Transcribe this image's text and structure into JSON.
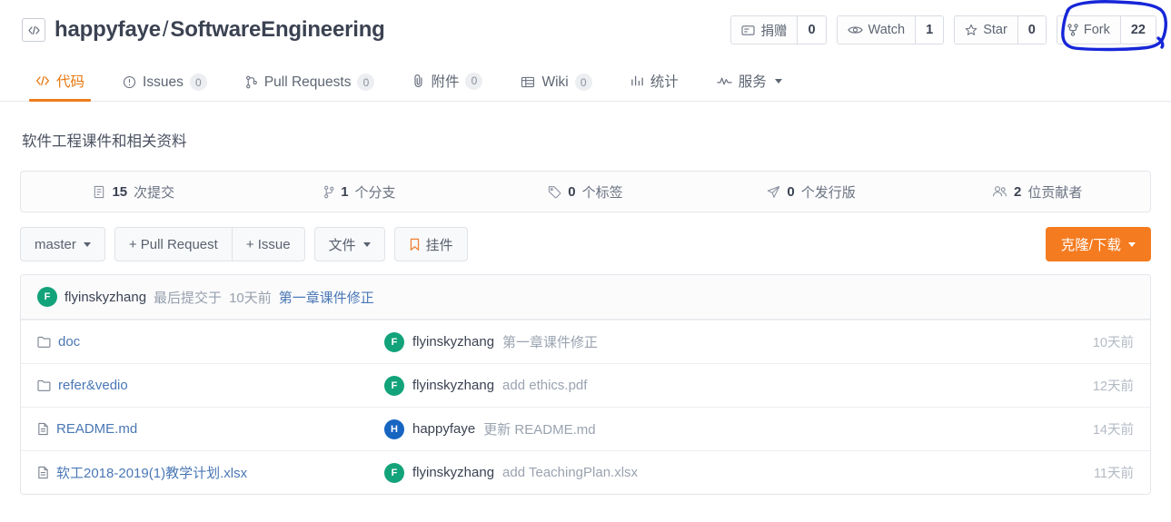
{
  "header": {
    "logo_icon": "code-brackets-icon",
    "owner": "happyfaye",
    "separator": "/",
    "repo": "SoftwareEngineering",
    "actions": [
      {
        "icon": "donate-icon",
        "label": "捐赠",
        "count": "0",
        "name": "donate"
      },
      {
        "icon": "eye-icon",
        "label": "Watch",
        "count": "1",
        "name": "watch"
      },
      {
        "icon": "star-icon",
        "label": "Star",
        "count": "0",
        "name": "star"
      },
      {
        "icon": "fork-icon",
        "label": "Fork",
        "count": "22",
        "name": "fork"
      }
    ],
    "annotation": {
      "target": "fork-button",
      "shape": "hand-drawn-circle",
      "color": "#1626d8"
    }
  },
  "tabs": [
    {
      "icon": "code-icon",
      "label": "代码",
      "badge": "",
      "active": true,
      "caret": false
    },
    {
      "icon": "issue-icon",
      "label": "Issues",
      "badge": "0",
      "active": false,
      "caret": false
    },
    {
      "icon": "pull-request-icon",
      "label": "Pull Requests",
      "badge": "0",
      "active": false,
      "caret": false
    },
    {
      "icon": "paperclip-icon",
      "label": "附件",
      "badge": "0",
      "active": false,
      "caret": false
    },
    {
      "icon": "wiki-icon",
      "label": "Wiki",
      "badge": "0",
      "active": false,
      "caret": false
    },
    {
      "icon": "chart-icon",
      "label": "统计",
      "badge": "",
      "active": false,
      "caret": false
    },
    {
      "icon": "activity-icon",
      "label": "服务",
      "badge": "",
      "active": false,
      "caret": true
    }
  ],
  "description": "软件工程课件和相关资料",
  "stats": [
    {
      "icon": "commit-icon",
      "value": "15",
      "label": "次提交"
    },
    {
      "icon": "branch-icon",
      "value": "1",
      "label": "个分支"
    },
    {
      "icon": "tag-icon",
      "value": "0",
      "label": "个标签"
    },
    {
      "icon": "release-icon",
      "value": "0",
      "label": "个发行版"
    },
    {
      "icon": "contributor-icon",
      "value": "2",
      "label": "位贡献者"
    }
  ],
  "toolbar": {
    "branch": "master",
    "pull_request": "+ Pull Request",
    "issue": "+ Issue",
    "files": "文件",
    "widget": "挂件",
    "clone_download": "克隆/下载"
  },
  "commit_head": {
    "avatar_letter": "F",
    "author": "flyinskyzhang",
    "prefix": "最后提交于",
    "time": "10天前",
    "message": "第一章课件修正"
  },
  "file_columns": {
    "name": "",
    "commit": "",
    "time": ""
  },
  "files": [
    {
      "icon": "folder-icon",
      "name": "doc",
      "avatar_letter": "F",
      "avatar_color": "green",
      "author": "flyinskyzhang",
      "message": "第一章课件修正",
      "time": "10天前"
    },
    {
      "icon": "folder-icon",
      "name": "refer&vedio",
      "avatar_letter": "F",
      "avatar_color": "green",
      "author": "flyinskyzhang",
      "message": "add ethics.pdf",
      "time": "12天前"
    },
    {
      "icon": "file-icon",
      "name": "README.md",
      "avatar_letter": "H",
      "avatar_color": "blue",
      "author": "happyfaye",
      "message": "更新 README.md",
      "time": "14天前"
    },
    {
      "icon": "file-icon",
      "name": "软工2018-2019(1)教学计划.xlsx",
      "avatar_letter": "F",
      "avatar_color": "green",
      "author": "flyinskyzhang",
      "message": "add TeachingPlan.xlsx",
      "time": "11天前"
    }
  ],
  "colors": {
    "accent_orange": "#f47b20",
    "link_blue": "#4a77b5",
    "annotation_blue": "#1626d8",
    "avatar_green": "#13a37a",
    "avatar_blue": "#1765c1"
  }
}
